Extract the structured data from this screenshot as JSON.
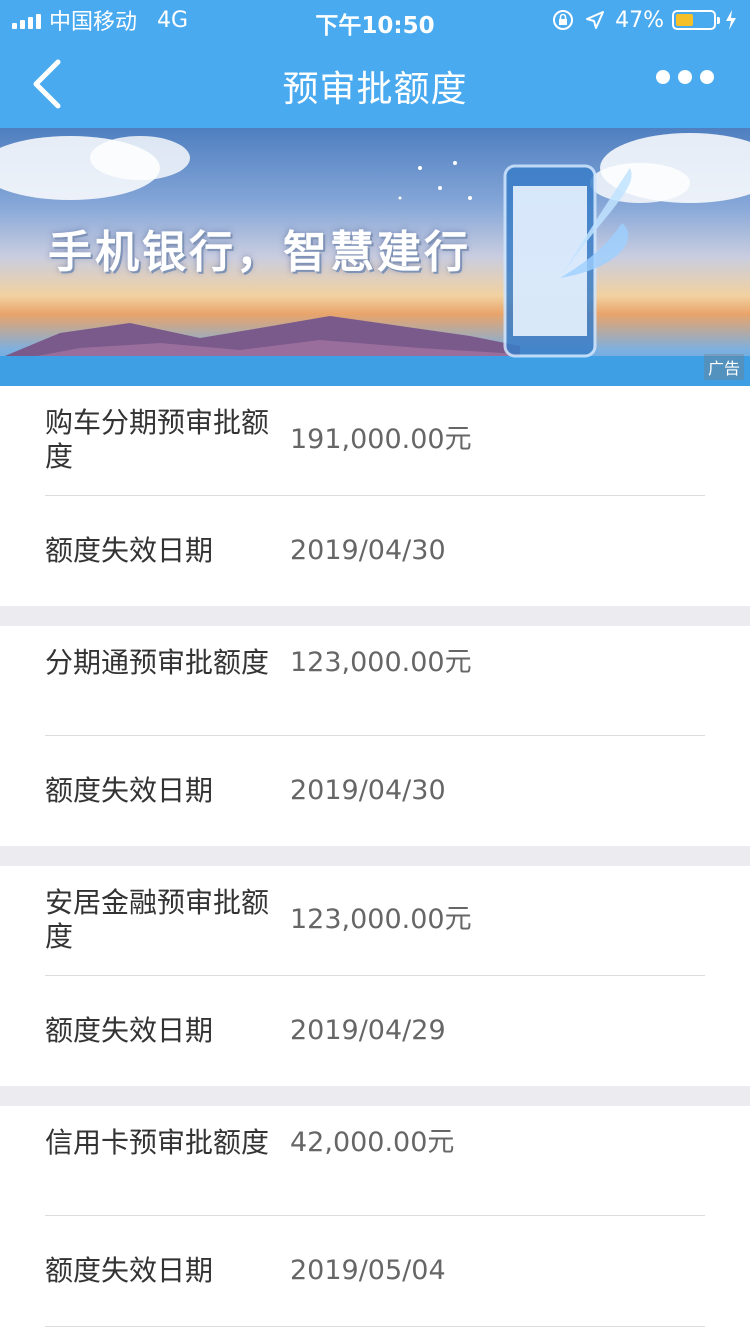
{
  "status_bar": {
    "carrier": "中国移动",
    "network": "4G",
    "time": "下午10:50",
    "battery_percent": "47%",
    "battery_level": 0.47
  },
  "nav": {
    "title": "预审批额度",
    "back_icon": "chevron-left-icon",
    "more_icon": "more-dots-icon"
  },
  "banner": {
    "slogan": "手机银行，智慧建行",
    "ad_label": "广告"
  },
  "cards": [
    {
      "label": "购车分期预审批额度",
      "value": "191,000.00元",
      "expiry_label": "额度失效日期",
      "expiry_date": "2019/04/30"
    },
    {
      "label": "分期通预审批额度",
      "value": "123,000.00元",
      "expiry_label": "额度失效日期",
      "expiry_date": "2019/04/30"
    },
    {
      "label": "安居金融预审批额度",
      "value": "123,000.00元",
      "expiry_label": "额度失效日期",
      "expiry_date": "2019/04/29"
    },
    {
      "label": "信用卡预审批额度",
      "value": "42,000.00元",
      "expiry_label": "额度失效日期",
      "expiry_date": "2019/05/04"
    }
  ],
  "colors": {
    "nav_bg": "#4aaaf0",
    "page_bg": "#ececf0",
    "label_text": "#333333",
    "value_text": "#666666"
  }
}
